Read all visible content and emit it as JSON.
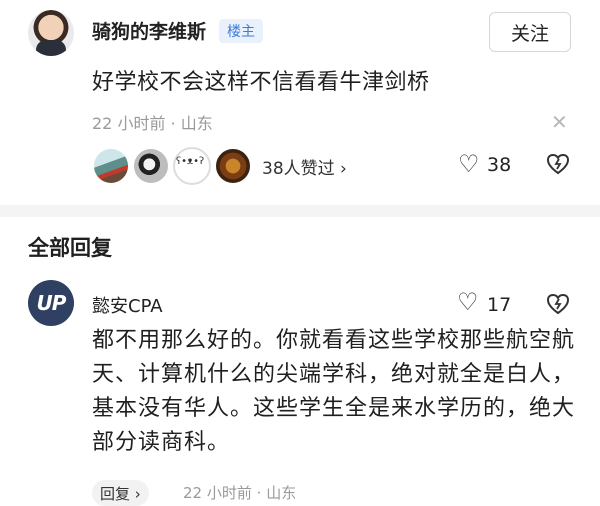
{
  "op": {
    "username": "骑狗的李维斯",
    "badge": "楼主",
    "follow_label": "关注",
    "content": "好学校不会这样不信看看牛津剑桥",
    "time": "22 小时前",
    "separator": "·",
    "location": "山东",
    "likes_text": "38人赞过 ›",
    "like_count": "38"
  },
  "replies_section": {
    "title": "全部回复"
  },
  "reply": {
    "avatar_text": "UP",
    "username": "懿安CPA",
    "like_count": "17",
    "content": "都不用那么好的。你就看看这些学校那些航空航天、计算机什么的尖端学科，绝对就全是白人，基本没有华人。这些学生全是来水学历的，绝大部分读商科。",
    "reply_label": "回复 ›",
    "time": "22 小时前",
    "separator": "·",
    "location": "山东"
  },
  "icons": {
    "heart": "heart-icon",
    "share": "share-icon",
    "close": "close-icon"
  }
}
